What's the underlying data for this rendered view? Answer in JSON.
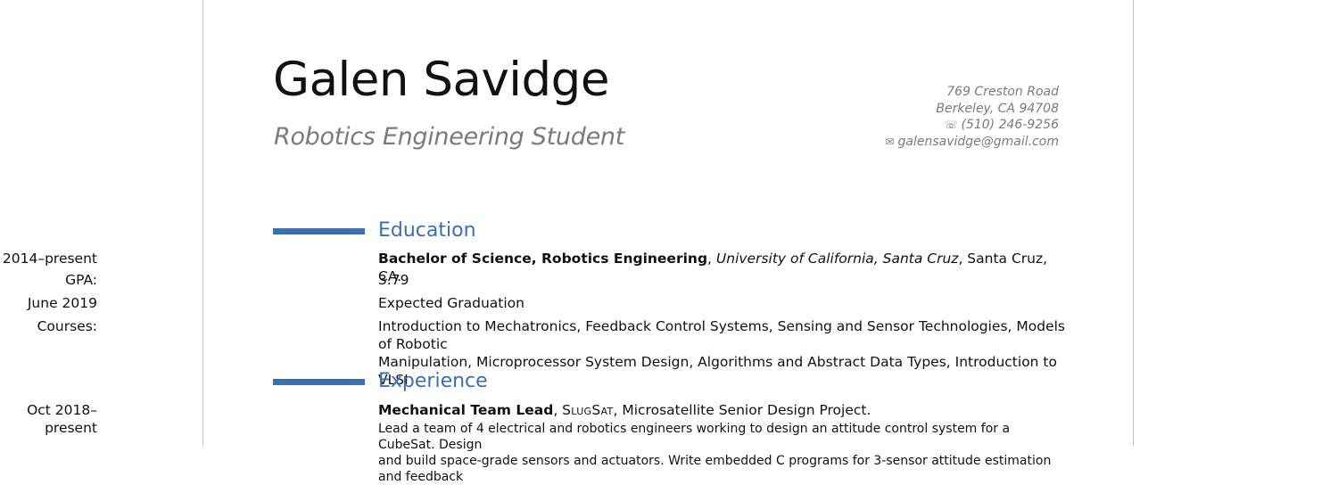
{
  "header": {
    "name": "Galen Savidge",
    "title": "Robotics Engineering Student",
    "address_line1": "769 Creston Road",
    "address_line2": "Berkeley, CA 94708",
    "phone": "(510) 246-9256",
    "email": "galensavidge@gmail.com"
  },
  "education": {
    "heading": "Education",
    "entries": [
      {
        "label": "2014–present",
        "degree": "Bachelor of Science, Robotics Engineering",
        "school": "University of California, Santa Cruz",
        "location": "Santa Cruz, CA."
      },
      {
        "label": "GPA:",
        "value": "3.79"
      },
      {
        "label": "June 2019",
        "value": "Expected Graduation"
      },
      {
        "label": "Courses:",
        "value_line1": "Introduction to Mechatronics, Feedback Control Systems, Sensing and Sensor Technologies, Models of Robotic",
        "value_line2": "Manipulation, Microprocessor System Design, Algorithms and Abstract Data Types, Introduction to VLSI"
      }
    ]
  },
  "experience": {
    "heading": "Experience",
    "entries": [
      {
        "label_line1": "Oct 2018–",
        "label_line2": "present",
        "role": "Mechanical Team Lead",
        "org": "SlugSat",
        "project": "Microsatellite Senior Design Project.",
        "desc_line1": "Lead a team of 4 electrical and robotics engineers working to design an attitude control system for a CubeSat. Design",
        "desc_line2": "and build space-grade sensors and actuators. Write embedded C programs for 3-sensor attitude estimation and feedback"
      }
    ]
  },
  "colors": {
    "accent": "#3c6fb0",
    "muted": "#7b7b7b",
    "text": "#111111"
  },
  "icons": {
    "phone": "phone-icon",
    "email": "envelope-icon"
  }
}
